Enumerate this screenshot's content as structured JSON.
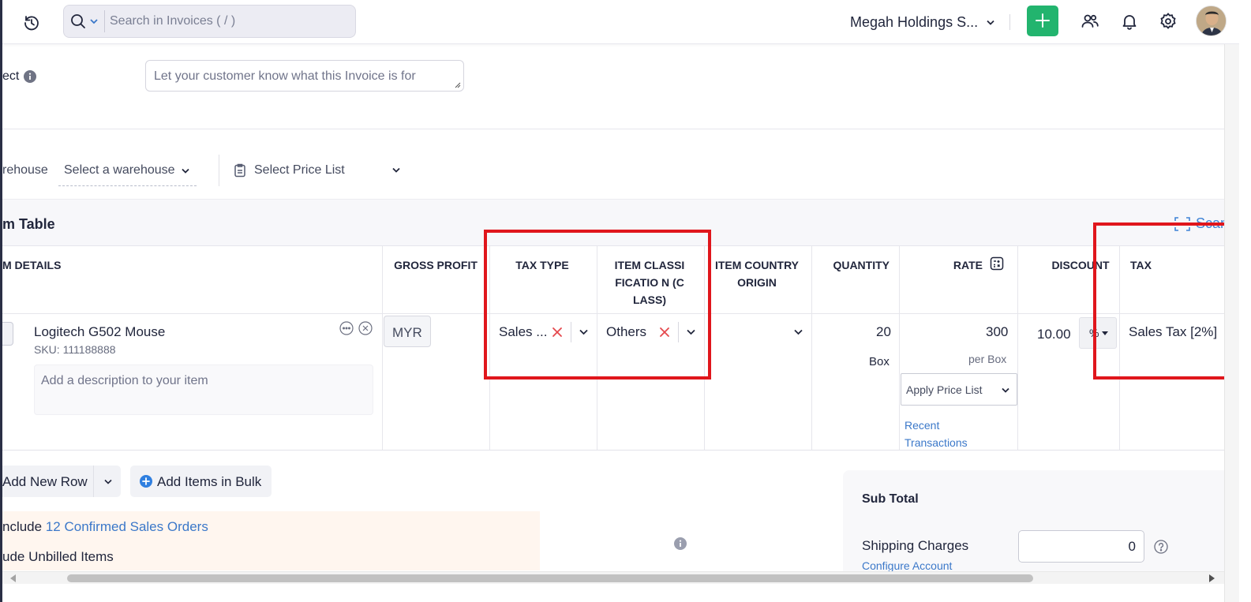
{
  "search": {
    "placeholder": "Search in Invoices ( / )"
  },
  "header": {
    "organization": "Megah Holdings S..."
  },
  "subject": {
    "label": "ect",
    "placeholder": "Let your customer know what this Invoice is for"
  },
  "warehouse": {
    "label": "rehouse",
    "select_placeholder": "Select a warehouse"
  },
  "price_list": {
    "select_placeholder": "Select Price List"
  },
  "item_table": {
    "title": "m Table",
    "scan_label": "Scan",
    "columns": {
      "item_details": "M DETAILS",
      "gross_profit": "GROSS PROFIT",
      "tax_type": "TAX TYPE",
      "item_classification": "ITEM CLASSIFICATIO N (CLASS)",
      "item_country_origin": "ITEM COUNTRY ORIGIN",
      "quantity": "QUANTITY",
      "rate": "RATE",
      "discount": "DISCOUNT",
      "tax": "TAX"
    },
    "row": {
      "name": "Logitech G502 Mouse",
      "sku": "SKU: 111188888",
      "description_placeholder": "Add a description to your item",
      "gross_profit_currency": "MYR",
      "tax_type": "Sales ...",
      "item_classification": "Others",
      "quantity": "20",
      "unit": "Box",
      "rate": "300",
      "rate_unit": "per Box",
      "apply_price_list": "Apply Price List",
      "recent_transactions": "Recent Transactions",
      "discount": "10.00",
      "discount_type": "%",
      "tax": "Sales Tax [2%]"
    }
  },
  "actions": {
    "add_new_row": "Add New Row",
    "add_items_in_bulk": "Add Items in Bulk"
  },
  "notice": {
    "include_prefix": "nclude",
    "confirmed_sales_orders": "12 Confirmed Sales Orders",
    "unbilled_items": "ude Unbilled Items"
  },
  "summary": {
    "sub_total_label": "Sub Total",
    "shipping_charges_label": "Shipping Charges",
    "configure_account": "Configure Account",
    "shipping_value": "0"
  },
  "colors": {
    "accent_green": "#22b46e",
    "link_blue": "#3b78c9",
    "highlight_red": "#e0161c"
  }
}
